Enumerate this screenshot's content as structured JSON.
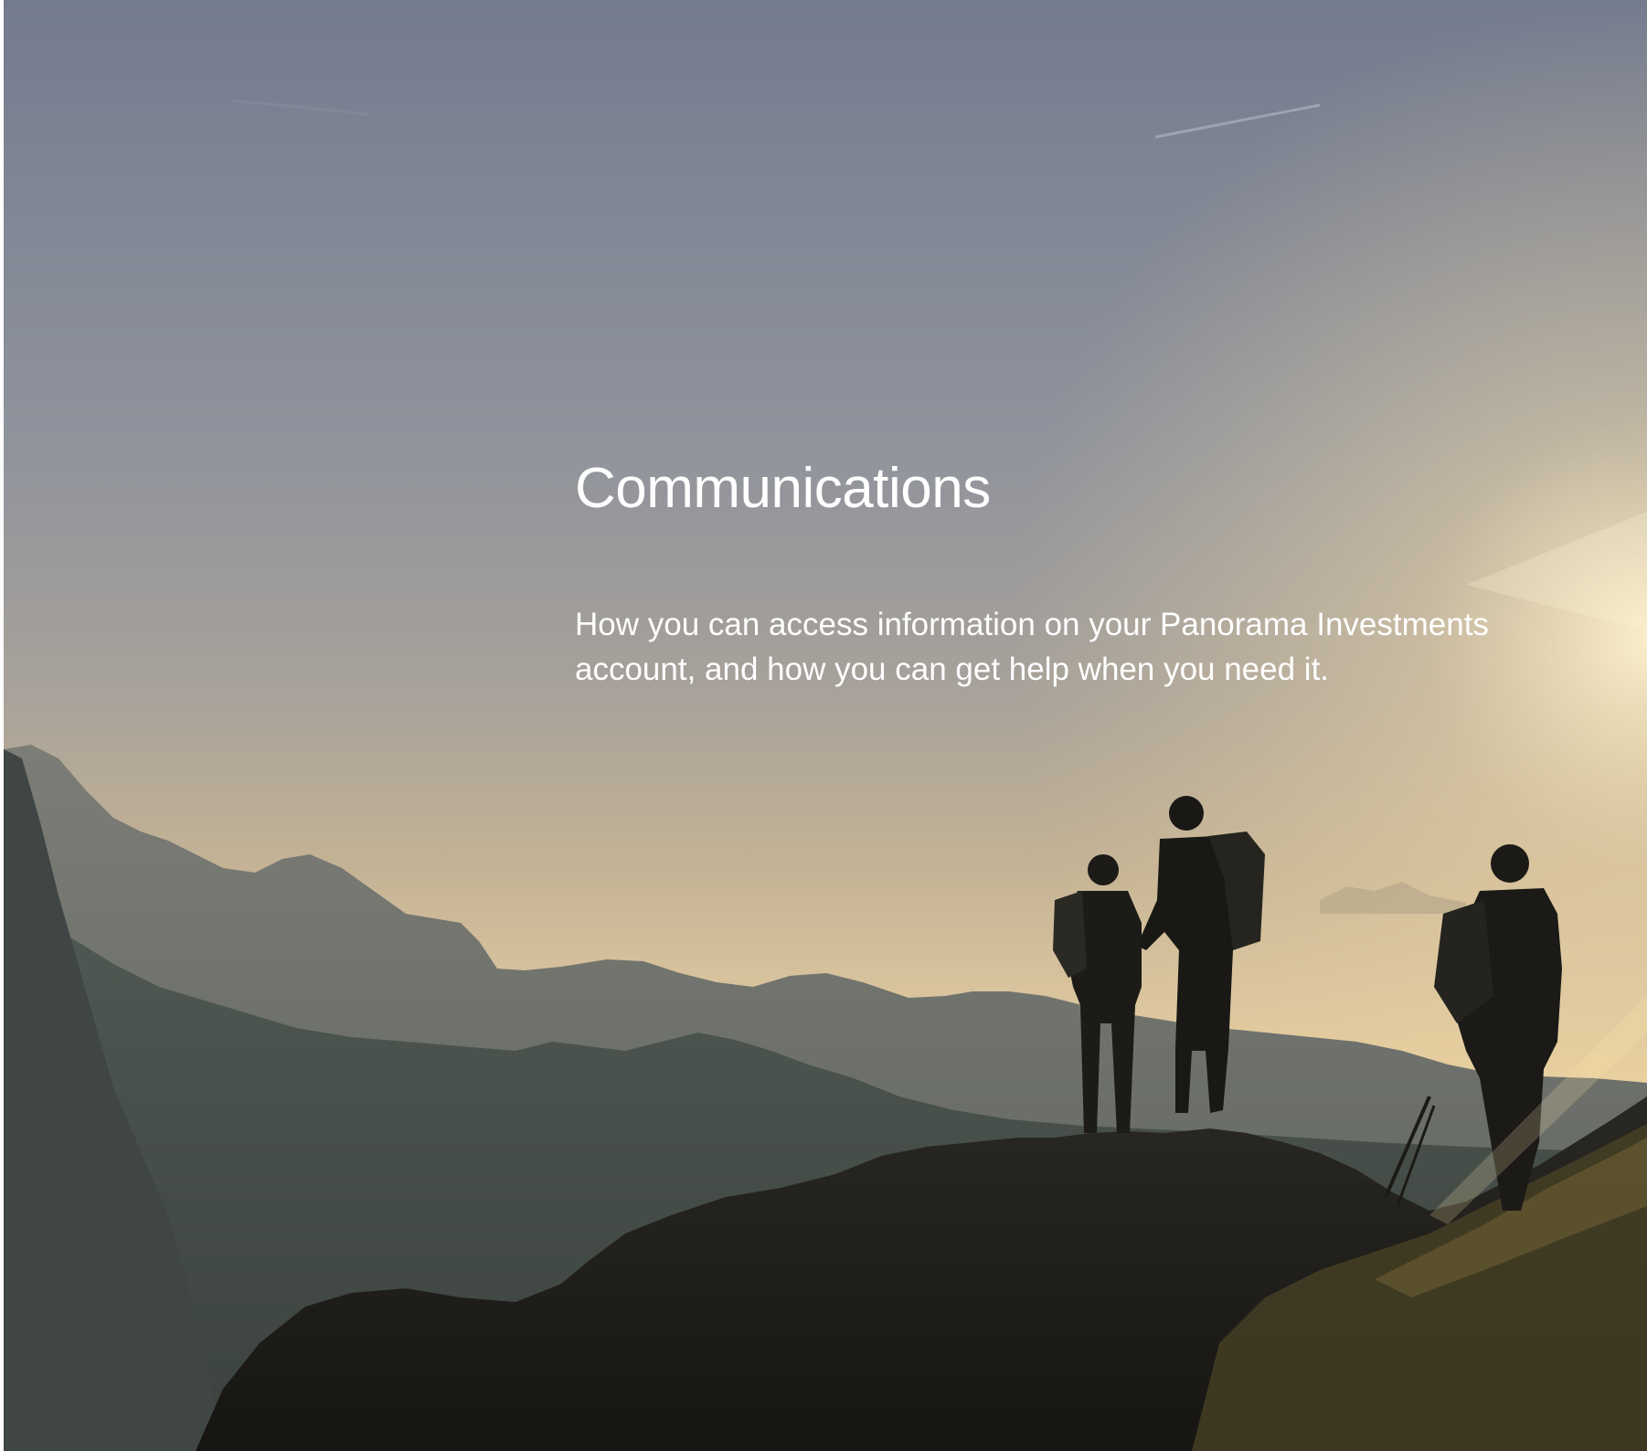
{
  "section": {
    "title": "Communications",
    "description": "How you can access information on your Panorama Investments account, and how you can get help when you need it."
  },
  "hero_image": {
    "subject": "silhouette-of-three-hikers-on-mountain-ridge-at-sunset",
    "colors": {
      "sky_top": "#737b8e",
      "sky_mid": "#a39e98",
      "horizon": "#e8cf9e",
      "far_mountains": "#6b6f6c",
      "mid_mountains": "#4c5452",
      "foreground": "#1d1c19"
    }
  }
}
